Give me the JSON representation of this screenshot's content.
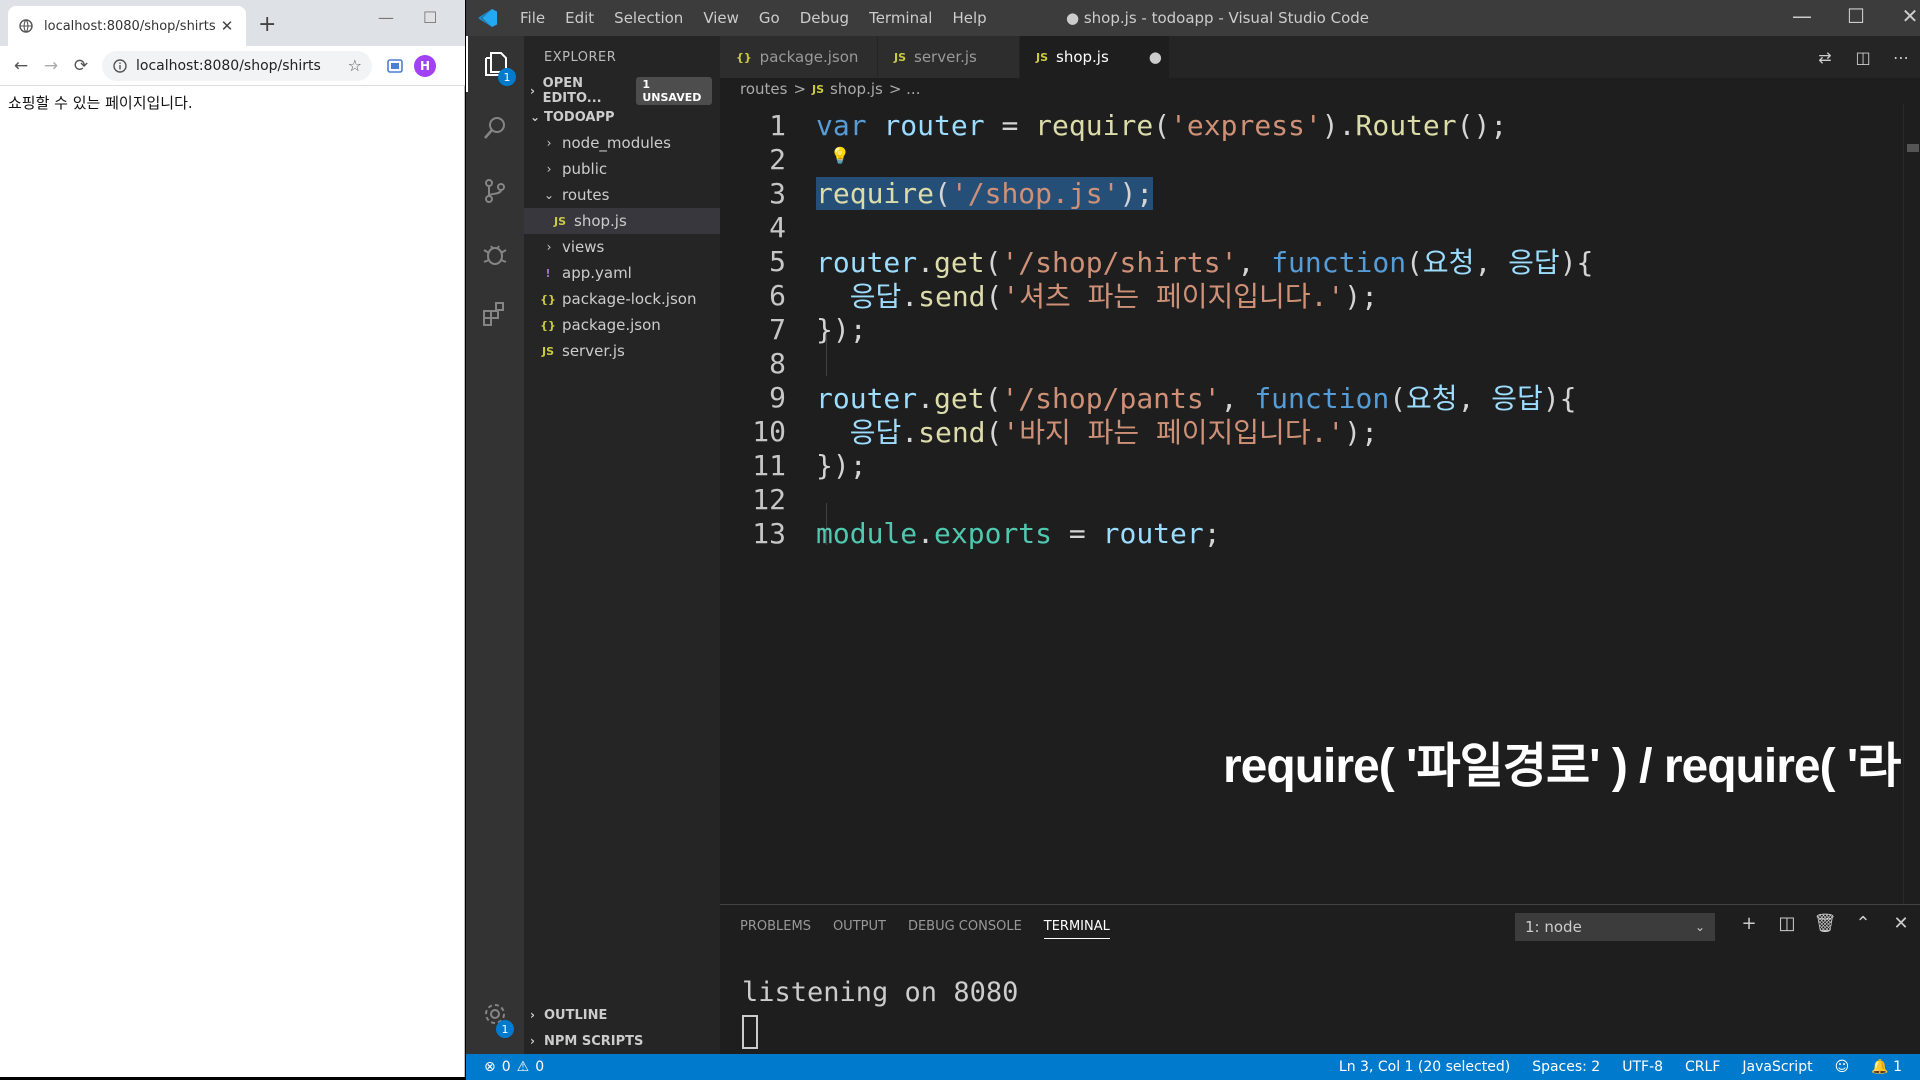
{
  "browser": {
    "tab_title": "localhost:8080/shop/shirts",
    "address": "localhost:8080/shop/shirts",
    "avatar_letter": "H",
    "page_text": "쇼핑할 수 있는 페이지입니다."
  },
  "vscode": {
    "title": "● shop.js - todoapp - Visual Studio Code",
    "menu": [
      "File",
      "Edit",
      "Selection",
      "View",
      "Go",
      "Debug",
      "Terminal",
      "Help"
    ],
    "explorer_badge": "1",
    "settings_badge": "1",
    "sidebar": {
      "header": "EXPLORER",
      "open_editors": "OPEN EDITO...",
      "unsaved": "1 UNSAVED",
      "project": "TODOAPP",
      "items": [
        {
          "label": "node_modules"
        },
        {
          "label": "public"
        },
        {
          "label": "routes"
        },
        {
          "label": "shop.js",
          "icon": "JS"
        },
        {
          "label": "views"
        },
        {
          "label": "app.yaml",
          "icon": "!"
        },
        {
          "label": "package-lock.json",
          "icon": "{}"
        },
        {
          "label": "package.json",
          "icon": "{}"
        },
        {
          "label": "server.js",
          "icon": "JS"
        }
      ],
      "outline": "OUTLINE",
      "npm_scripts": "NPM SCRIPTS"
    },
    "tabs": [
      {
        "icon": "{}",
        "label": "package.json"
      },
      {
        "icon": "JS",
        "label": "server.js"
      },
      {
        "icon": "JS",
        "label": "shop.js",
        "dirty": "●"
      }
    ],
    "breadcrumb": {
      "folder": "routes",
      "sep": ">",
      "icon": "JS",
      "file": "shop.js",
      "more": "> ..."
    },
    "line_numbers": [
      "1",
      "2",
      "3",
      "4",
      "5",
      "6",
      "7",
      "8",
      "9",
      "10",
      "11",
      "12",
      "13"
    ],
    "code": {
      "l1": [
        "var",
        " ",
        "router",
        " = ",
        "require",
        "(",
        "'express'",
        ").",
        "Router",
        "();"
      ],
      "l3": [
        "require",
        "(",
        "'/shop.js'",
        ");"
      ],
      "l5": [
        "router",
        ".",
        "get",
        "(",
        "'/shop/shirts'",
        ", ",
        "function",
        "(",
        "요청",
        ", ",
        "응답",
        "){"
      ],
      "l6": [
        "  ",
        "응답",
        ".",
        "send",
        "(",
        "'셔츠 파는 페이지입니다.'",
        ");"
      ],
      "l7": [
        "});"
      ],
      "l9": [
        "router",
        ".",
        "get",
        "(",
        "'/shop/pants'",
        ", ",
        "function",
        "(",
        "요청",
        ", ",
        "응답",
        "){"
      ],
      "l10": [
        "  ",
        "응답",
        ".",
        "send",
        "(",
        "'바지 파는 페이지입니다.'",
        ");"
      ],
      "l11": [
        "});"
      ],
      "l13": [
        "module",
        ".",
        "exports",
        " = ",
        "router",
        ";"
      ]
    },
    "caption": "require( '파일경로' ) / require( '라이브러리명' )",
    "panel": {
      "tabs": [
        "PROBLEMS",
        "OUTPUT",
        "DEBUG CONSOLE",
        "TERMINAL"
      ],
      "terminal_select": "1: node",
      "terminal_output": "listening on 8080"
    },
    "status": {
      "errors": "0",
      "warnings": "0",
      "position": "Ln 3, Col 1 (20 selected)",
      "spaces": "Spaces: 2",
      "encoding": "UTF-8",
      "eol": "CRLF",
      "language": "JavaScript",
      "notifications": "1"
    }
  }
}
